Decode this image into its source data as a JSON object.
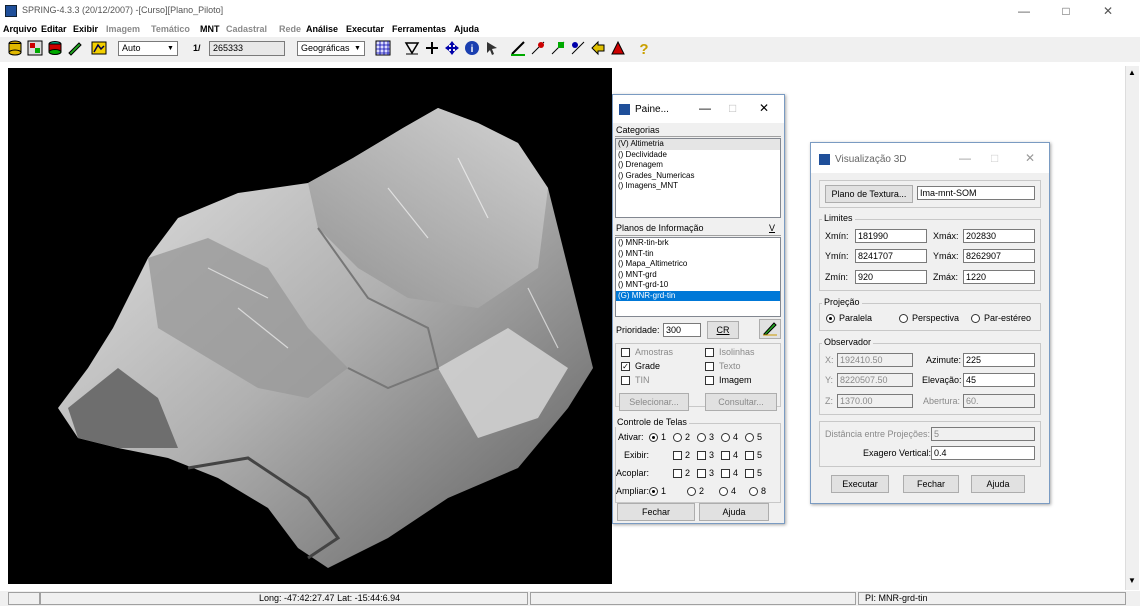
{
  "app": {
    "title": "SPRING-4.3.3 (20/12/2007) -[Curso][Plano_Piloto]"
  },
  "menu": [
    "Arquivo",
    "Editar",
    "Exibir",
    "Imagem",
    "Temático",
    "MNT",
    "Cadastral",
    "Rede",
    "Análise",
    "Executar",
    "Ferramentas",
    "Ajuda"
  ],
  "toolbar": {
    "scale_mode": "Auto",
    "scale_prefix": "1/",
    "scale_value": "265333",
    "projection": "Geográficas"
  },
  "status": {
    "coords": "Long: -47:42:27.47 Lat: -15:44:6.94",
    "plan": "PI: MNR-grd-tin"
  },
  "paine": {
    "title": "Paine...",
    "categorias_label": "Categorias",
    "categorias": [
      "(V) Altimetria",
      "() Declividade",
      "() Drenagem",
      "() Grades_Numericas",
      "() Imagens_MNT"
    ],
    "planos_label": "Planos de Informação",
    "planos_v": "V",
    "planos": [
      "() MNR-tin-brk",
      "() MNT-tin",
      "() Mapa_Altimetrico",
      "() MNT-grd",
      "() MNT-grd-10",
      "(G) MNR-grd-tin"
    ],
    "prioridade_label": "Prioridade:",
    "prioridade_value": "300",
    "cr_label": "CR",
    "amostras": "Amostras",
    "isolinhas": "Isolinhas",
    "grade": "Grade",
    "texto": "Texto",
    "tin": "TIN",
    "imagem": "Imagem",
    "selecionar": "Selecionar...",
    "consultar": "Consultar...",
    "controle_label": "Controle de Telas",
    "ativar": "Ativar:",
    "exibir": "Exibir:",
    "acoplar": "Acoplar:",
    "ampliar": "Ampliar:",
    "n1": "1",
    "n2": "2",
    "n3": "3",
    "n4": "4",
    "n5": "5",
    "n8": "8",
    "fechar": "Fechar",
    "ajuda": "Ajuda"
  },
  "vis3d": {
    "title": "Visualização 3D",
    "plano_textura_btn": "Plano de Textura...",
    "plano_textura_value": "Ima-mnt-SOM",
    "limites_label": "Limites",
    "xmin_label": "Xmín:",
    "xmin": "181990",
    "xmax_label": "Xmáx:",
    "xmax": "202830",
    "ymin_label": "Ymín:",
    "ymin": "8241707",
    "ymax_label": "Ymáx:",
    "ymax": "8262907",
    "zmin_label": "Zmín:",
    "zmin": "920",
    "zmax_label": "Zmáx:",
    "zmax": "1220",
    "projecao_label": "Projeção",
    "paralela": "Paralela",
    "perspectiva": "Perspectiva",
    "parestereo": "Par-estéreo",
    "observador_label": "Observador",
    "x_label": "X:",
    "x": "192410.50",
    "y_label": "Y:",
    "y": "8220507.50",
    "z_label": "Z:",
    "z": "1370.00",
    "azimute_label": "Azimute:",
    "azimute": "225",
    "elevacao_label": "Elevação:",
    "elevacao": "45",
    "abertura_label": "Abertura:",
    "abertura": "60.",
    "distancia_label": "Distância entre Projeções:",
    "distancia": "5",
    "exagero_label": "Exagero Vertical:",
    "exagero": "0.4",
    "executar": "Executar",
    "fechar": "Fechar",
    "ajuda": "Ajuda"
  },
  "colors": {
    "selection": "#0078d7",
    "canvas_bg": "#000000",
    "panel_border": "#7a9bc2"
  }
}
